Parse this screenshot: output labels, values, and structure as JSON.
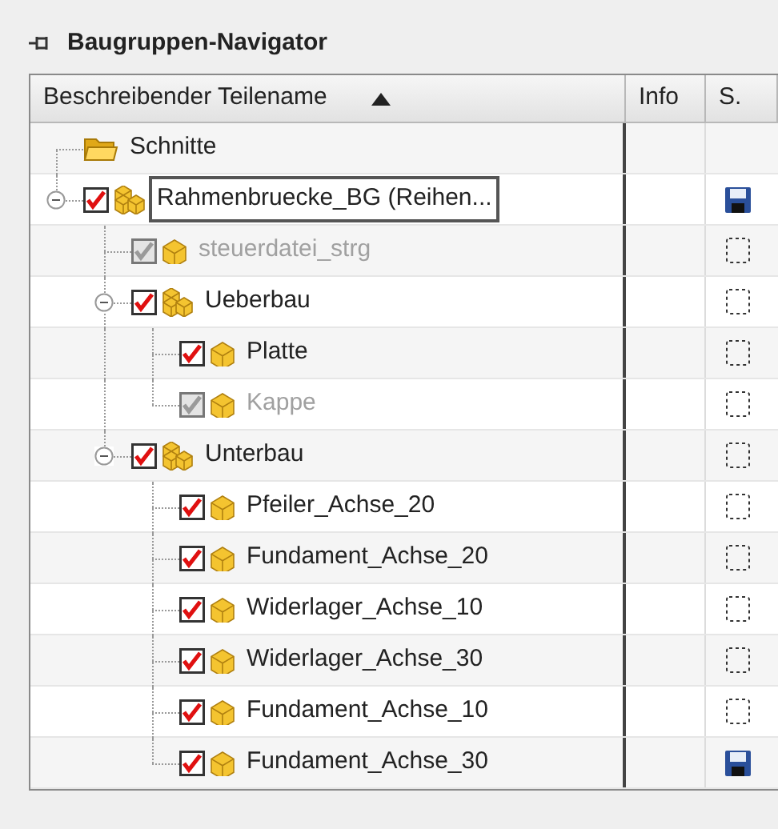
{
  "panel": {
    "title": "Baugruppen-Navigator"
  },
  "columns": [
    {
      "label": "Beschreibender Teilename",
      "sorted": true
    },
    {
      "label": "Info",
      "sorted": false
    },
    {
      "label": "S.",
      "sorted": false
    }
  ],
  "tree": [
    {
      "kind": "folder",
      "label": "Schnitte"
    },
    {
      "kind": "assembly",
      "label": "Rahmenbruecke_BG (Reihen...",
      "checked": true,
      "disabled": false,
      "expanded": true,
      "focused": true,
      "saved": true,
      "children": [
        {
          "kind": "part",
          "label": "steuerdatei_strg",
          "checked": true,
          "disabled": true,
          "saved": false
        },
        {
          "kind": "assembly",
          "label": "Ueberbau",
          "checked": true,
          "disabled": false,
          "expanded": true,
          "saved": false,
          "children": [
            {
              "kind": "part",
              "label": "Platte",
              "checked": true,
              "disabled": false,
              "saved": false
            },
            {
              "kind": "part",
              "label": "Kappe",
              "checked": true,
              "disabled": true,
              "saved": false
            }
          ]
        },
        {
          "kind": "assembly",
          "label": "Unterbau",
          "checked": true,
          "disabled": false,
          "expanded": true,
          "saved": false,
          "children": [
            {
              "kind": "part",
              "label": "Pfeiler_Achse_20",
              "checked": true,
              "disabled": false,
              "saved": false
            },
            {
              "kind": "part",
              "label": "Fundament_Achse_20",
              "checked": true,
              "disabled": false,
              "saved": false
            },
            {
              "kind": "part",
              "label": "Widerlager_Achse_10",
              "checked": true,
              "disabled": false,
              "saved": false
            },
            {
              "kind": "part",
              "label": "Widerlager_Achse_30",
              "checked": true,
              "disabled": false,
              "saved": false
            },
            {
              "kind": "part",
              "label": "Fundament_Achse_10",
              "checked": true,
              "disabled": false,
              "saved": false
            },
            {
              "kind": "part",
              "label": "Fundament_Achse_30",
              "checked": true,
              "disabled": false,
              "saved": true
            }
          ]
        }
      ]
    }
  ]
}
